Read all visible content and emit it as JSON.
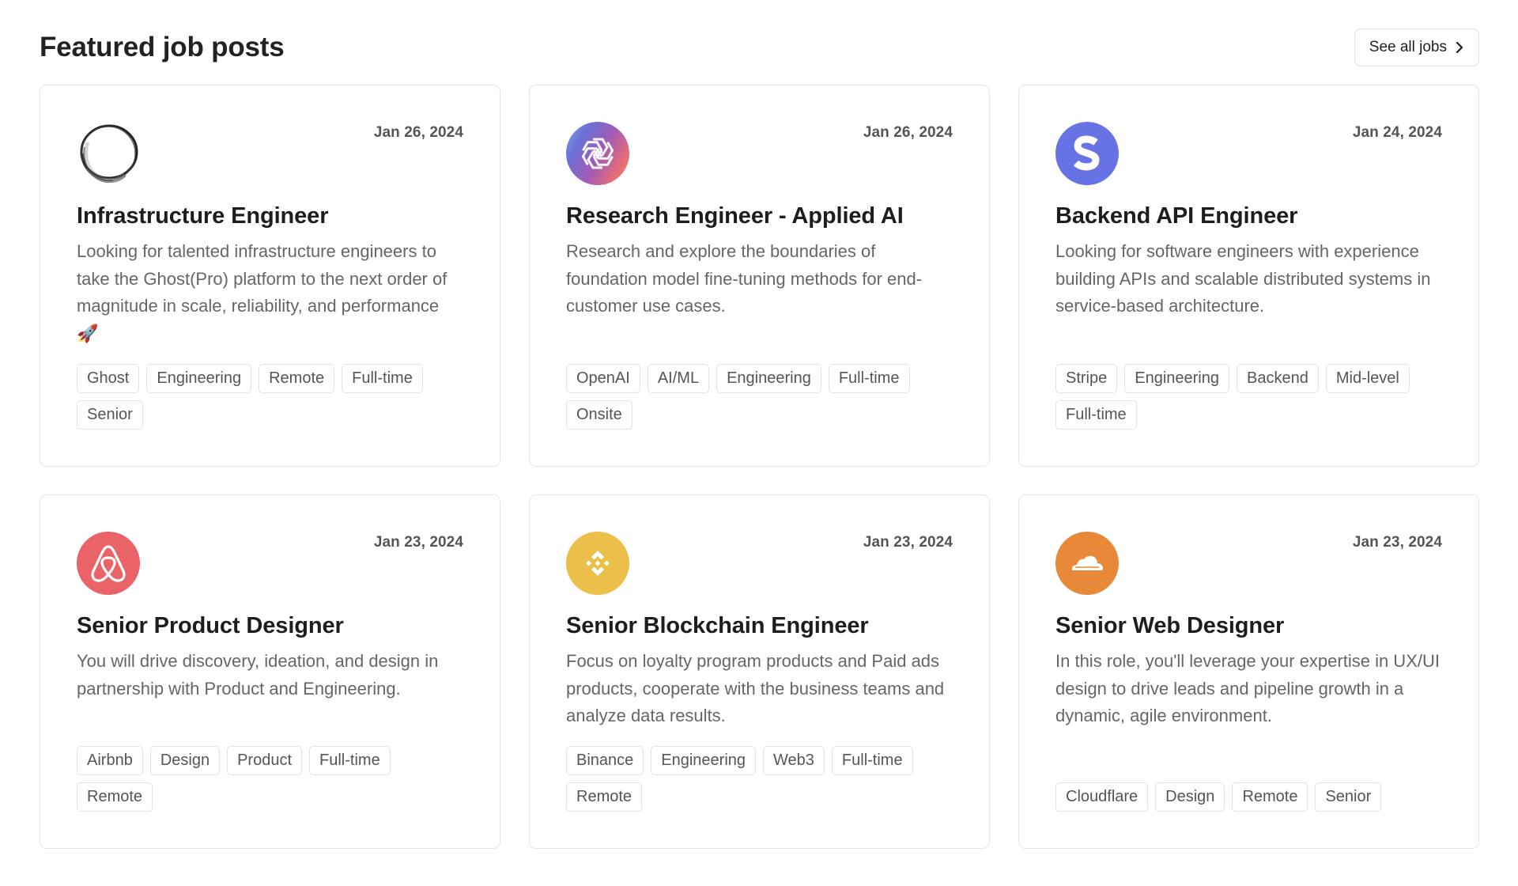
{
  "header": {
    "title": "Featured job posts",
    "see_all_label": "See all jobs"
  },
  "colors": {
    "ghost": "#ffffff",
    "openai_gradient": [
      "#6a8fe0",
      "#a35bb6",
      "#e8706b"
    ],
    "stripe": "#6772e5",
    "airbnb": "#ea6366",
    "binance": "#ecbf4b",
    "cloudflare": "#e8893a",
    "tag_border": "#e3e3e3",
    "card_border": "#e6e6e6"
  },
  "jobs": [
    {
      "company": "Ghost",
      "logo_icon": "ghost-logo-icon",
      "date": "Jan 26, 2024",
      "title": "Infrastructure Engineer",
      "description": "Looking for talented infrastructure engineers to take the Ghost(Pro) platform to the next order of magnitude in scale, reliability, and performance 🚀",
      "tags": [
        "Ghost",
        "Engineering",
        "Remote",
        "Full-time",
        "Senior"
      ]
    },
    {
      "company": "OpenAI",
      "logo_icon": "openai-logo-icon",
      "date": "Jan 26, 2024",
      "title": "Research Engineer - Applied AI",
      "description": "Research and explore the boundaries of foundation model fine-tuning methods for end-customer use cases.",
      "tags": [
        "OpenAI",
        "AI/ML",
        "Engineering",
        "Full-time",
        "Onsite"
      ]
    },
    {
      "company": "Stripe",
      "logo_icon": "stripe-logo-icon",
      "date": "Jan 24, 2024",
      "title": "Backend API Engineer",
      "description": "Looking for software engineers with experience building APIs and scalable distributed systems in service-based architecture.",
      "tags": [
        "Stripe",
        "Engineering",
        "Backend",
        "Mid-level",
        "Full-time"
      ]
    },
    {
      "company": "Airbnb",
      "logo_icon": "airbnb-logo-icon",
      "date": "Jan 23, 2024",
      "title": "Senior Product Designer",
      "description": "You will drive discovery, ideation, and design in partnership with Product and Engineering.",
      "tags": [
        "Airbnb",
        "Design",
        "Product",
        "Full-time",
        "Remote"
      ]
    },
    {
      "company": "Binance",
      "logo_icon": "binance-logo-icon",
      "date": "Jan 23, 2024",
      "title": "Senior Blockchain Engineer",
      "description": "Focus on loyalty program products and Paid ads products, cooperate with the business teams and analyze data results.",
      "tags": [
        "Binance",
        "Engineering",
        "Web3",
        "Full-time",
        "Remote"
      ]
    },
    {
      "company": "Cloudflare",
      "logo_icon": "cloudflare-logo-icon",
      "date": "Jan 23, 2024",
      "title": "Senior Web Designer",
      "description": "In this role, you'll leverage your expertise in UX/UI design to drive leads and pipeline growth in a dynamic, agile environment.",
      "tags": [
        "Cloudflare",
        "Design",
        "Remote",
        "Senior"
      ]
    }
  ]
}
